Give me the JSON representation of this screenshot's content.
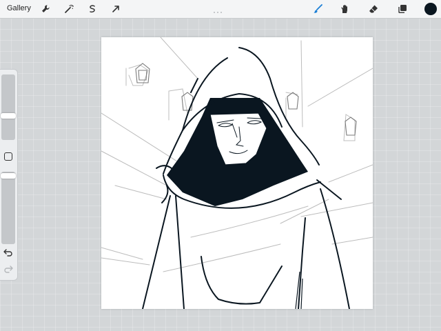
{
  "topbar": {
    "gallery_label": "Gallery",
    "left_tools": [
      "wrench-icon",
      "magic-wand-icon",
      "selection-icon",
      "transform-arrow-icon"
    ],
    "right_tools": [
      "brush-icon",
      "smudge-icon",
      "eraser-icon",
      "layers-icon"
    ],
    "active_tool": "brush",
    "current_color": "#0a1620",
    "accent_color": "#1b7fd6"
  },
  "sidebar": {
    "brush_size_level": 0.65,
    "opacity_level": 0.9,
    "icons": [
      "square-modify-icon",
      "undo-icon",
      "redo-icon"
    ]
  },
  "canvas": {
    "background": "#ffffff",
    "artwork": "sketch-hooded-figure"
  }
}
